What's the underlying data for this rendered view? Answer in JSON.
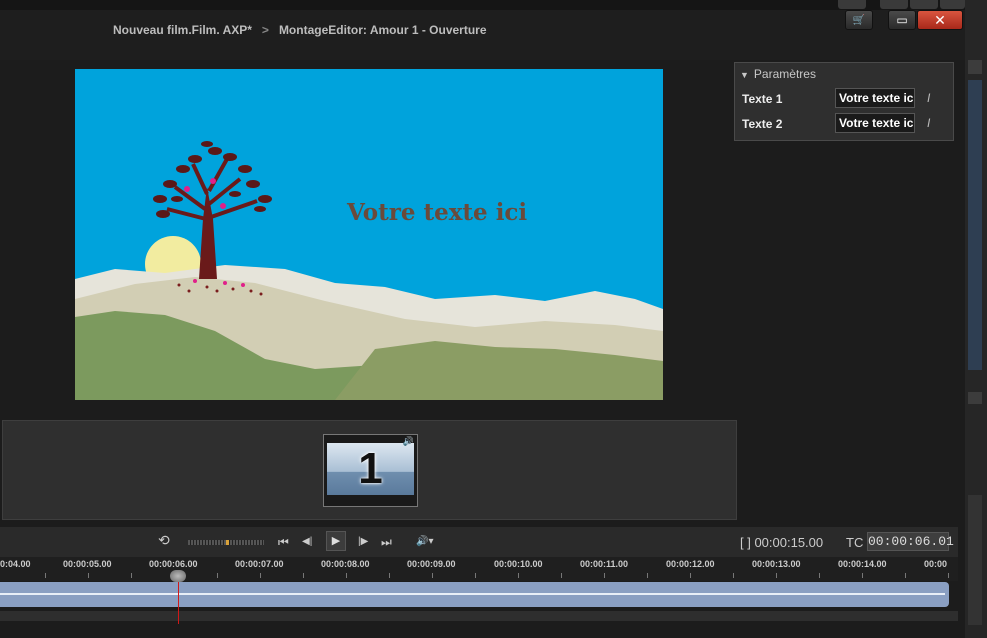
{
  "breadcrumb": {
    "project": "Nouveau film.Film. AXP*",
    "separator": ">",
    "editor": "MontageEditor: Amour  1 - Ouverture"
  },
  "window": {
    "cart_icon": "cart-icon",
    "maximize_icon": "maximize-icon",
    "close_icon": "close-icon",
    "close_glyph": "✕",
    "maximize_glyph": "▭",
    "cart_glyph": "🛒"
  },
  "preview": {
    "title_text": "Votre texte ici"
  },
  "params": {
    "title": "Paramètres",
    "rows": [
      {
        "label": "Texte 1",
        "value": "Votre texte ici"
      },
      {
        "label": "Texte 2",
        "value": "Votre texte ici"
      }
    ],
    "edit_glyph": "I"
  },
  "storyboard": {
    "clip_number": "1",
    "clip_vol_glyph": "🔊"
  },
  "transport": {
    "loop_glyph": "⟲",
    "first_glyph": "⏮",
    "prev_frame_glyph": "◀|",
    "play_glyph": "▶",
    "next_frame_glyph": "|▶",
    "last_glyph": "⏭",
    "volume_glyph": "🔊▾",
    "duration": "[ ] 00:00:15.00",
    "tc_label": "TC",
    "tc_value": "00:00:06.01",
    "scrub_position": 0.5
  },
  "ruler": {
    "labels": [
      "0:04.00",
      "00:00:05.00",
      "00:00:06.00",
      "00:00:07.00",
      "00:00:08.00",
      "00:00:09.00",
      "00:00:10.00",
      "00:00:11.00",
      "00:00:12.00",
      "00:00:13.00",
      "00:00:14.00",
      "00:00"
    ]
  },
  "colors": {
    "sky": "#00a3dc",
    "close": "#c8372a",
    "track": "#8a9fc2",
    "playhead": "#d01818"
  }
}
